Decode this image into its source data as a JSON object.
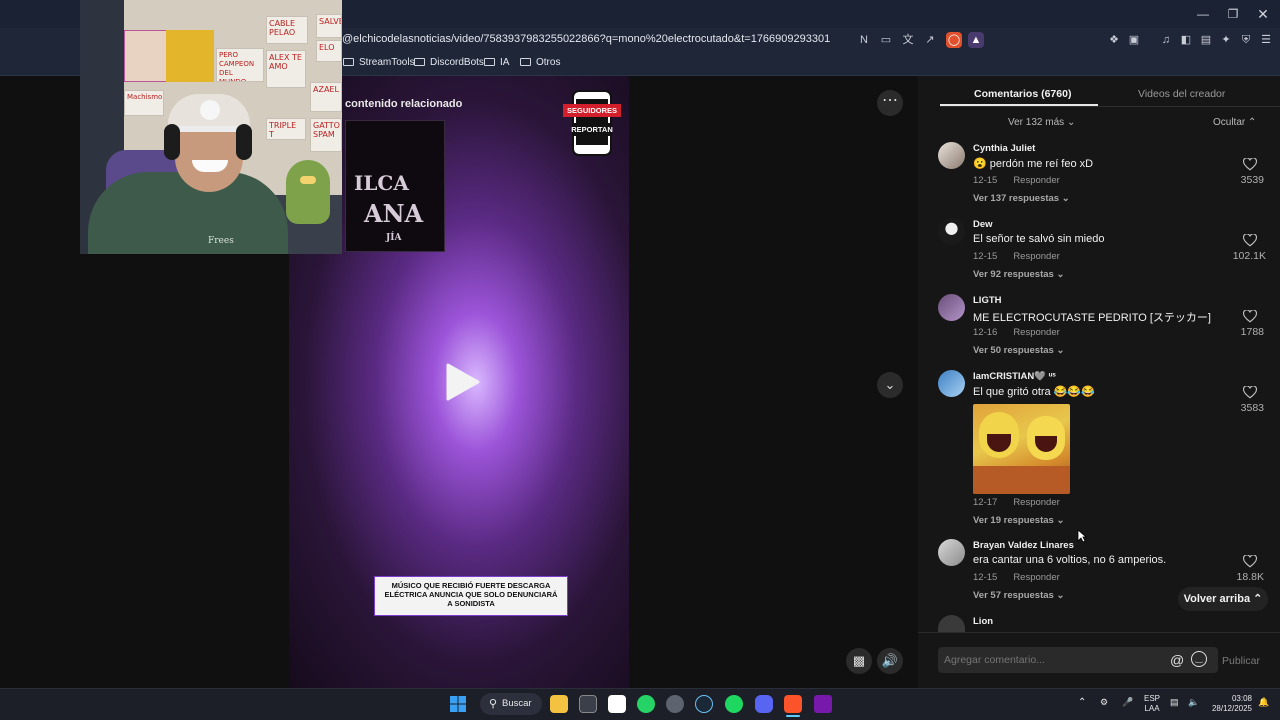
{
  "browser": {
    "url": "@elchicodelasnoticias/video/7583937983255022866?q=mono%20electrocutado&t=1766909293301",
    "bookmarks": [
      "StreamTools",
      "DiscordBots",
      "IA",
      "Otros"
    ]
  },
  "video": {
    "related_label": "contenido relacionado",
    "neon_line1": "ILCA",
    "neon_line2": "ANA",
    "neon_line3": "JÍA",
    "badge_top": "SEGUIDORES",
    "badge_bottom": "REPORTAN",
    "caption": "MÚSICO QUE RECIBIÓ FUERTE DESCARGA ELÉCTRICA ANUNCIA QUE SOLO DENUNCIARÁ A SONIDISTA"
  },
  "webcam": {
    "papers": [
      "CABLE PELAO",
      "ALEX TE AMO",
      "PERO CAMPEON DEL MUNDO JOSE",
      "Machismo",
      "TRIPLE T",
      "GATTO SPAM",
      "AZAEL",
      "SALVE",
      "ELO"
    ],
    "shirt_text": "Frees"
  },
  "panel": {
    "tabs": [
      "Comentarios (6760)",
      "Videos del creador"
    ],
    "ver_mas": "Ver 132 más",
    "ocultar": "Ocultar",
    "comments": [
      {
        "name": "Cynthia Juliet",
        "text": "perdón me reí feo xD",
        "date": "12-15",
        "reply": "Responder",
        "replies": "Ver 137 respuestas",
        "likes": "3539",
        "emoji": "😮"
      },
      {
        "name": "Dew",
        "text": "El señor te salvó sin miedo",
        "date": "12-15",
        "reply": "Responder",
        "replies": "Ver 92 respuestas",
        "likes": "102.1K"
      },
      {
        "name": "LIGTH",
        "text": "ME ELECTROCUTASTE PEDRITO [ステッカー]",
        "date": "12-16",
        "reply": "Responder",
        "replies": "Ver 50 respuestas",
        "likes": "1788"
      },
      {
        "name": "IamCRISTIAN🩶 ᵘˢ",
        "text": "El que gritó otra 😂😂😂",
        "date": "12-17",
        "reply": "Responder",
        "replies": "Ver 19 respuestas",
        "likes": "3583"
      },
      {
        "name": "Brayan Valdez Linares",
        "text": "era cantar una 6 voltios, no 6 amperios.",
        "date": "12-15",
        "reply": "Responder",
        "replies": "Ver 57 respuestas",
        "likes": "18.8K"
      },
      {
        "name": "Lion"
      }
    ],
    "volver_arriba": "Volver arriba",
    "comment_placeholder": "Agregar comentario...",
    "publicar": "Publicar"
  },
  "taskbar": {
    "search": "Buscar",
    "lang1": "ESP",
    "lang2": "LAA",
    "time": "03:08",
    "date": "28/12/2025"
  }
}
